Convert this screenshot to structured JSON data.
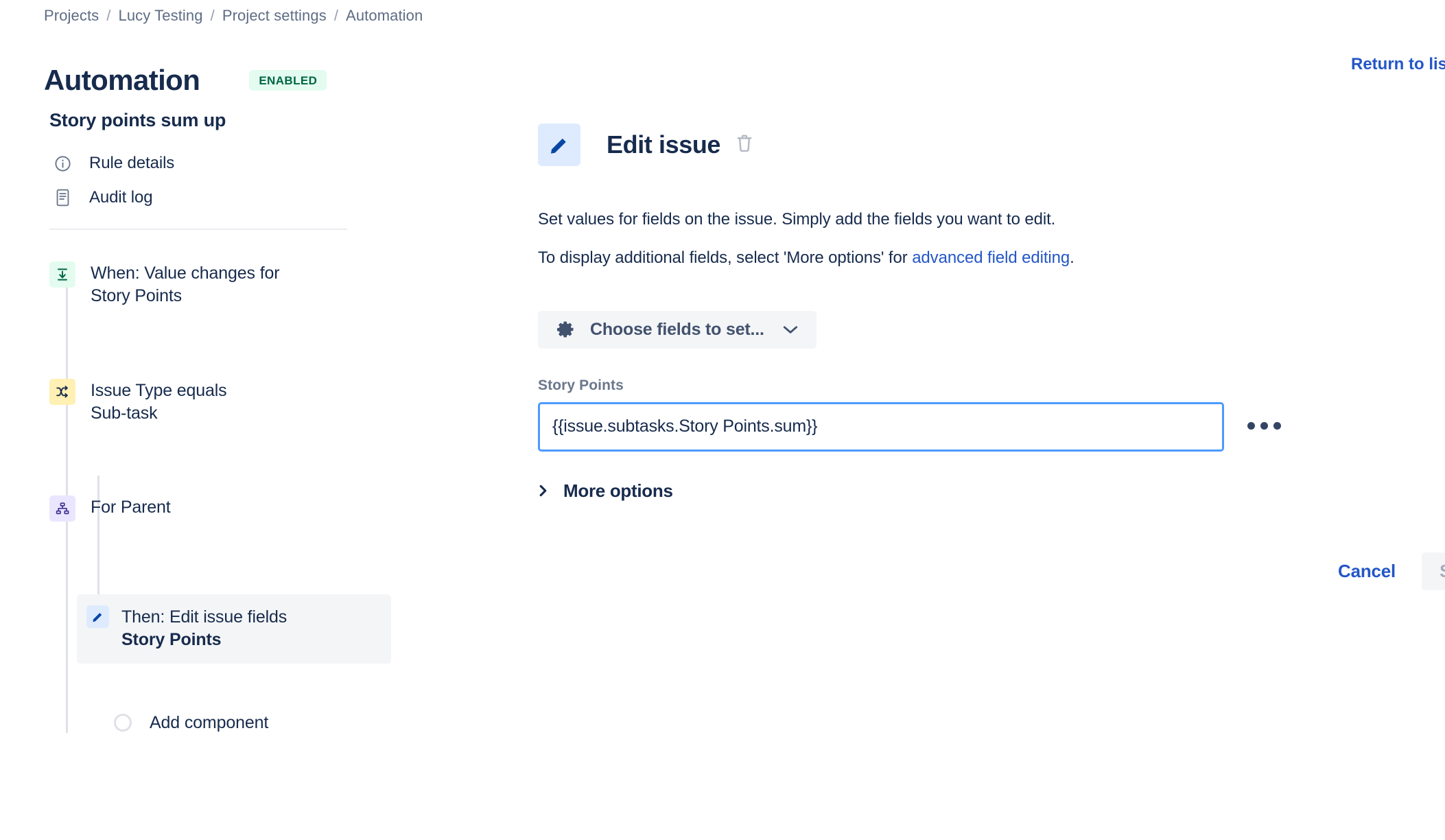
{
  "breadcrumb": {
    "items": [
      "Projects",
      "Lucy Testing",
      "Project settings",
      "Automation"
    ],
    "separator": "/"
  },
  "header": {
    "title": "Automation",
    "status_badge": "ENABLED",
    "status_badge_bg": "#E3FCEF",
    "status_badge_color": "#006644",
    "return_link": "Return to list"
  },
  "sidebar": {
    "rule_name": "Story points sum up",
    "nav_items": [
      {
        "label": "Rule details",
        "icon": "info-circle-icon"
      },
      {
        "label": "Audit log",
        "icon": "document-lines-icon"
      }
    ],
    "tree": {
      "trigger": {
        "title": "When: Value changes for",
        "subtitle": "Story Points",
        "icon": "value-changes-icon",
        "icon_bg": "#E3FCEF"
      },
      "condition": {
        "title": "Issue Type equals",
        "subtitle": "Sub-task",
        "icon": "shuffle-arrows-icon",
        "icon_bg": "#FFF0B3"
      },
      "branch": {
        "title": "For Parent",
        "subtitle": "",
        "icon": "hierarchy-branch-icon",
        "icon_bg": "#EAE6FF"
      },
      "action": {
        "title": "Then: Edit issue fields",
        "subtitle": "Story Points",
        "icon": "pencil-icon",
        "icon_bg": "#DEEBFF",
        "selected": true
      },
      "add_component": {
        "label": "Add component",
        "icon": "empty-circle-icon"
      }
    }
  },
  "panel": {
    "icon": "pencil-icon",
    "title": "Edit issue",
    "delete_icon": "trash-icon",
    "description_1": "Set values for fields on the issue. Simply add the fields you want to edit.",
    "description_2_prefix": "To display additional fields, select 'More options' for ",
    "description_2_link": "advanced field editing",
    "description_2_suffix": ".",
    "choose_fields": {
      "label": "Choose fields to set...",
      "icon": "gear-icon",
      "caret": "chevron-down-icon"
    },
    "field": {
      "label": "Story Points",
      "value": "{{issue.subtasks.Story Points.sum}}",
      "placeholder": "",
      "overflow_menu_icon": "more-horizontal-icon"
    },
    "more_options": {
      "label": "More options",
      "icon": "chevron-right-icon"
    },
    "buttons": {
      "cancel": "Cancel",
      "save": "Save",
      "save_disabled": true
    }
  },
  "colors": {
    "link": "#2456C7",
    "text": "#172B4D",
    "muted": "#5E6C84",
    "field_focus_border": "#4C9AFF",
    "surface_subtle": "#F4F5F7"
  }
}
